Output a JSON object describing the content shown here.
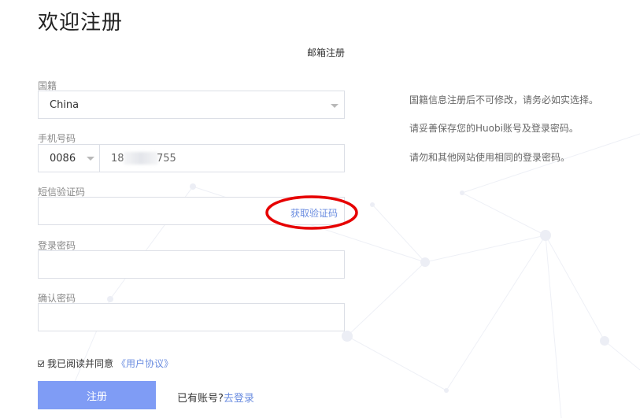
{
  "page": {
    "title": "欢迎注册",
    "reg_type_tab": "邮箱注册"
  },
  "form": {
    "nationality": {
      "label": "国籍",
      "value": "China"
    },
    "phone": {
      "label": "手机号码",
      "country_code": "0086",
      "value_prefix": "18",
      "value_suffix": "755"
    },
    "sms_code": {
      "label": "短信验证码",
      "get_code_label": "获取验证码"
    },
    "password": {
      "label": "登录密码"
    },
    "confirm_password": {
      "label": "确认密码"
    }
  },
  "hints": [
    "国籍信息注册后不可修改，请务必如实选择。",
    "请妥善保存您的Huobi账号及登录密码。",
    "请勿和其他网站使用相同的登录密码。"
  ],
  "agreement": {
    "checked": true,
    "text": "我已阅读并同意",
    "link": "《用户协议》"
  },
  "register_button": "注册",
  "login_prompt": {
    "text": "已有账号?",
    "link": "去登录"
  },
  "colors": {
    "primary_button": "#7f9cf5",
    "link": "#6b8de0",
    "annotation": "#e60000"
  }
}
